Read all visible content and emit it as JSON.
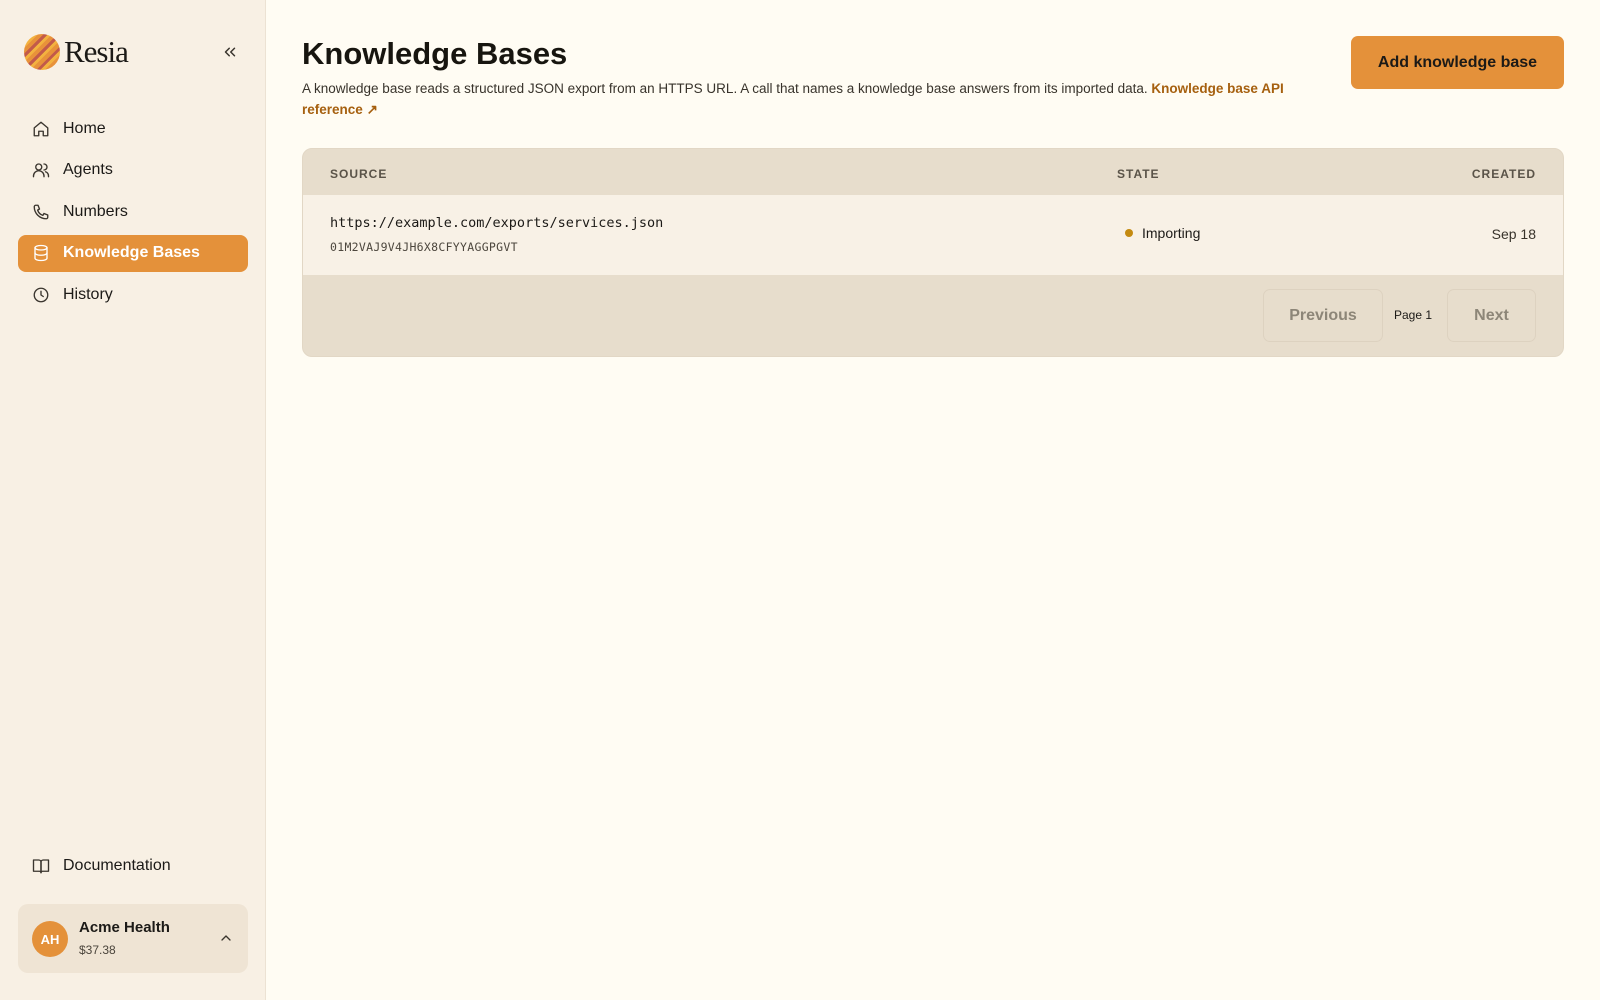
{
  "brand": {
    "name": "Resia"
  },
  "sidebar": {
    "items": [
      {
        "label": "Home",
        "icon": "home-icon"
      },
      {
        "label": "Agents",
        "icon": "users-icon"
      },
      {
        "label": "Numbers",
        "icon": "phone-icon"
      },
      {
        "label": "Knowledge Bases",
        "icon": "database-icon",
        "active": true
      },
      {
        "label": "History",
        "icon": "clock-icon"
      }
    ],
    "documentation": "Documentation"
  },
  "account": {
    "initials": "AH",
    "name": "Acme Health",
    "balance": "$37.38"
  },
  "header": {
    "title": "Knowledge Bases",
    "description": "A knowledge base reads a structured JSON export from an HTTPS URL. A call that names a knowledge base answers from its imported data.",
    "link_label": "Knowledge base API reference",
    "link_arrow": "↗",
    "add_button": "Add knowledge base"
  },
  "table": {
    "columns": {
      "source": "SOURCE",
      "state": "STATE",
      "created": "CREATED"
    },
    "rows": [
      {
        "url": "https://example.com/exports/services.json",
        "id": "01M2VAJ9V4JH6X8CFYYAGGPGVT",
        "state": "Importing",
        "created": "Sep 18"
      }
    ]
  },
  "pagination": {
    "previous": "Previous",
    "page": "Page 1",
    "next": "Next"
  },
  "colors": {
    "accent": "#e4913a",
    "background": "#fffcf3",
    "sidebar": "#f8f0e4",
    "status_importing": "#c48a10",
    "link": "#a6600f"
  }
}
